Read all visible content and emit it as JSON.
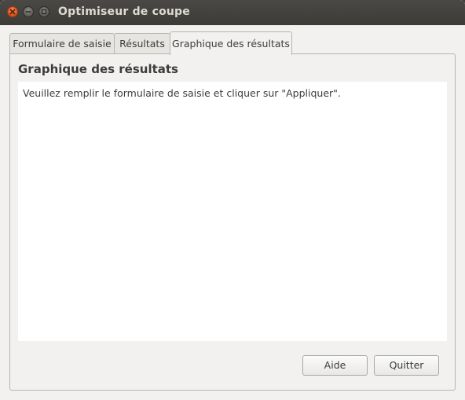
{
  "window": {
    "title": "Optimiseur de coupe"
  },
  "tabs": [
    {
      "label": "Formulaire de saisie",
      "active": false
    },
    {
      "label": "Résultats",
      "active": false
    },
    {
      "label": "Graphique des résultats",
      "active": true
    }
  ],
  "panel": {
    "title": "Graphique des résultats",
    "message": "Veuillez remplir le formulaire de saisie et cliquer sur \"Appliquer\"."
  },
  "buttons": {
    "help": "Aide",
    "quit": "Quitter"
  },
  "icons": {
    "close": "close-icon",
    "minimize": "minimize-icon",
    "maximize": "maximize-icon"
  },
  "colors": {
    "close_button": "#e2561f",
    "titlebar": "#3c3b37",
    "window_bg": "#f2f1f0",
    "content_bg": "#ffffff"
  }
}
